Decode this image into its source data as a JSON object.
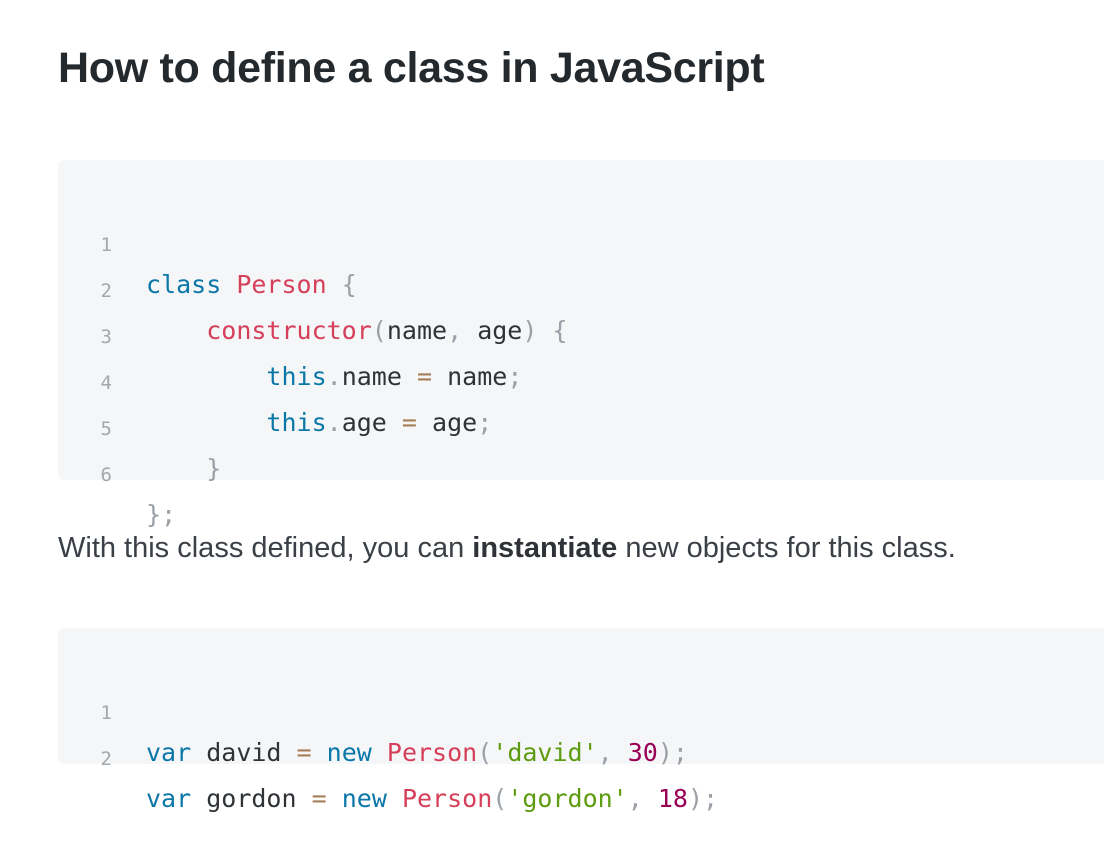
{
  "title": "How to define a class in JavaScript",
  "code_block_1": {
    "lines": [
      {
        "number": "1",
        "tokens": {
          "kw": "class",
          "cls": "Person",
          "brace": "{"
        }
      },
      {
        "number": "2",
        "tokens": {
          "fn": "constructor",
          "paren_open": "(",
          "p1": "name",
          "comma": ",",
          "p2": "age",
          "paren_close": ")",
          "brace": "{"
        }
      },
      {
        "number": "3",
        "tokens": {
          "kw": "this",
          "dot": ".",
          "prop": "name",
          "eq": "=",
          "val": "name",
          "semi": ";"
        }
      },
      {
        "number": "4",
        "tokens": {
          "kw": "this",
          "dot": ".",
          "prop": "age",
          "eq": "=",
          "val": "age",
          "semi": ";"
        }
      },
      {
        "number": "5",
        "tokens": {
          "brace": "}"
        }
      },
      {
        "number": "6",
        "tokens": {
          "brace": "}",
          "semi": ";"
        }
      }
    ]
  },
  "paragraph": {
    "before": "With this class defined, you can ",
    "bold": "instantiate",
    "after": " new objects for this class."
  },
  "code_block_2": {
    "lines": [
      {
        "number": "1",
        "tokens": {
          "kw": "var",
          "name": "david",
          "eq": "=",
          "new": "new",
          "cls": "Person",
          "paren_open": "(",
          "str": "'david'",
          "comma": ",",
          "num": "30",
          "paren_close": ")",
          "semi": ";"
        }
      },
      {
        "number": "2",
        "tokens": {
          "kw": "var",
          "name": "gordon",
          "eq": "=",
          "new": "new",
          "cls": "Person",
          "paren_open": "(",
          "str": "'gordon'",
          "comma": ",",
          "num": "18",
          "paren_close": ")",
          "semi": ";"
        }
      }
    ]
  },
  "colors": {
    "keyword": "#0a77a8",
    "class_name": "#d63f5a",
    "string": "#5d9b10",
    "number": "#990055",
    "operator": "#a67f59",
    "punctuation": "#9aa0a6",
    "code_background": "#f5f6f8"
  }
}
